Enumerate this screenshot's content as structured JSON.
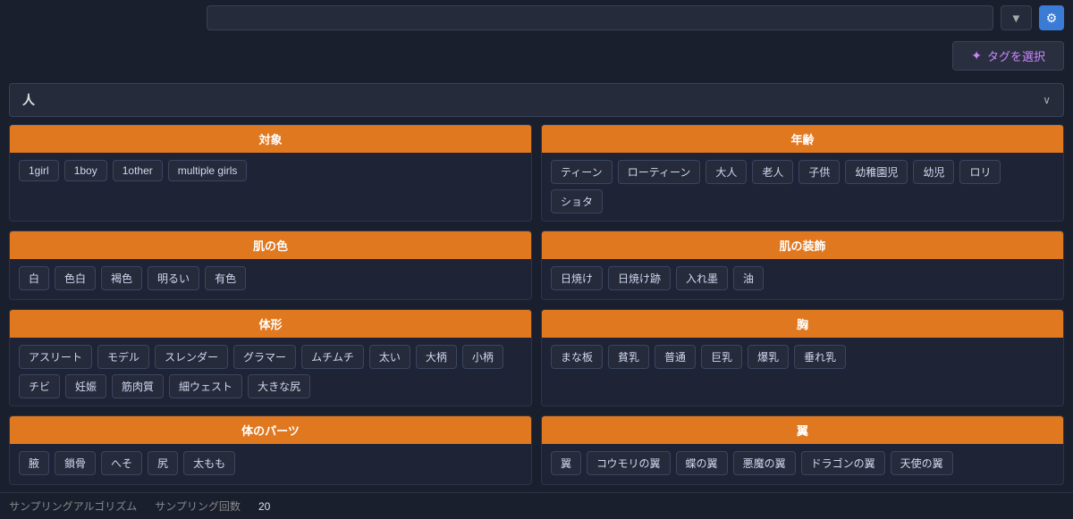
{
  "topBar": {
    "dropdownLabel": "▼",
    "iconLabel": "⚙"
  },
  "tagSelectButton": {
    "starIcon": "✦",
    "label": "タグを選択"
  },
  "sectionHeader": {
    "title": "人",
    "chevron": "∨"
  },
  "categories": [
    {
      "id": "target",
      "header": "対象",
      "tags": [
        "1girl",
        "1boy",
        "1other",
        "multiple girls"
      ]
    },
    {
      "id": "age",
      "header": "年齢",
      "tags": [
        "ティーン",
        "ローティーン",
        "大人",
        "老人",
        "子供",
        "幼稚園児",
        "幼児",
        "ロリ",
        "ショタ"
      ]
    },
    {
      "id": "skin-color",
      "header": "肌の色",
      "tags": [
        "白",
        "色白",
        "褐色",
        "明るい",
        "有色"
      ]
    },
    {
      "id": "skin-decoration",
      "header": "肌の装飾",
      "tags": [
        "日焼け",
        "日焼け跡",
        "入れ墨",
        "油"
      ]
    },
    {
      "id": "body-shape",
      "header": "体形",
      "tags": [
        "アスリート",
        "モデル",
        "スレンダー",
        "グラマー",
        "ムチムチ",
        "太い",
        "大柄",
        "小柄",
        "チビ",
        "妊娠",
        "筋肉質",
        "細ウェスト",
        "大きな尻"
      ]
    },
    {
      "id": "chest",
      "header": "胸",
      "tags": [
        "まな板",
        "貧乳",
        "普通",
        "巨乳",
        "爆乳",
        "垂れ乳"
      ]
    },
    {
      "id": "body-parts",
      "header": "体のパーツ",
      "tags": [
        "腋",
        "鎖骨",
        "へそ",
        "尻",
        "太もも"
      ]
    },
    {
      "id": "wings",
      "header": "翼",
      "tags": [
        "翼",
        "コウモリの翼",
        "蝶の翼",
        "悪魔の翼",
        "ドラゴンの翼",
        "天使の翼"
      ]
    }
  ],
  "bottomBar": {
    "label1": "サンプリングアルゴリズム",
    "label2": "サンプリング回数",
    "value2": "20"
  }
}
